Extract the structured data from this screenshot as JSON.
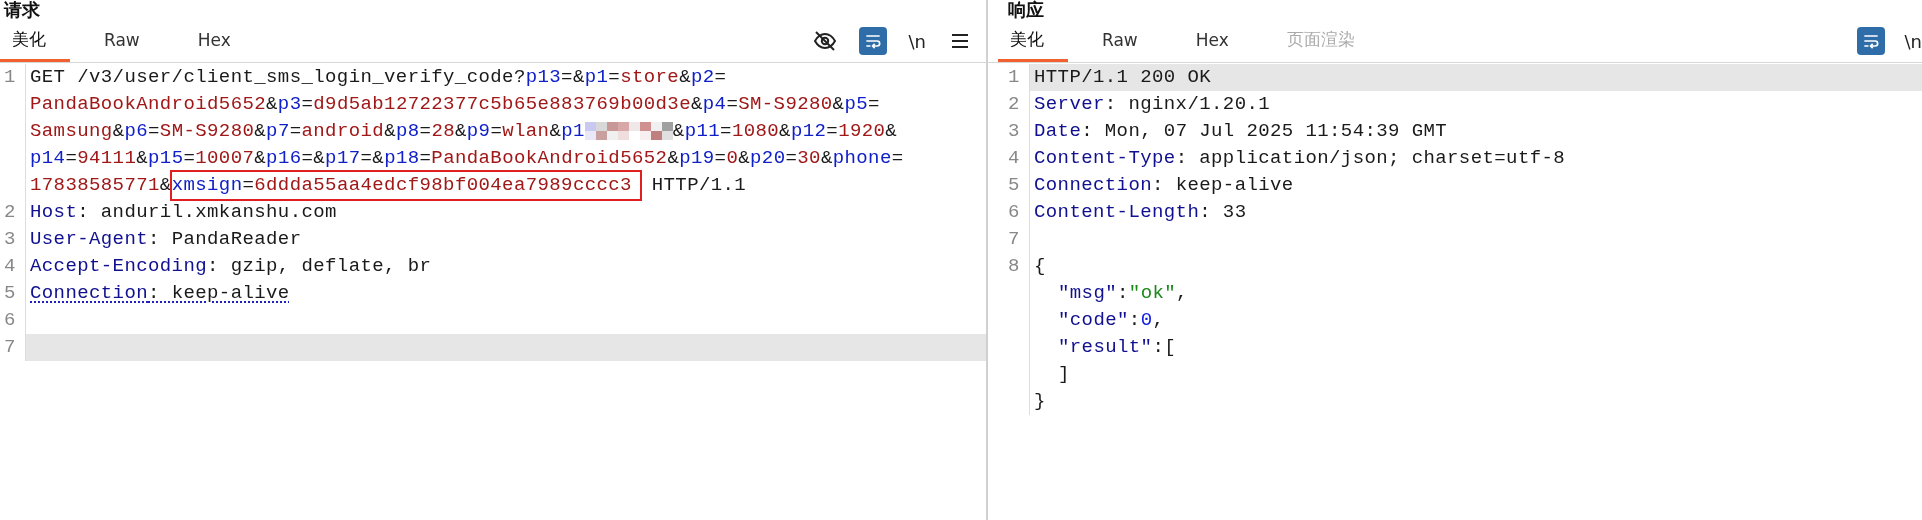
{
  "panels": [
    {
      "title": "请求",
      "tabs": [
        {
          "label": "美化",
          "selected": true,
          "disabled": false
        },
        {
          "label": "Raw",
          "selected": false,
          "disabled": false
        },
        {
          "label": "Hex",
          "selected": false,
          "disabled": false
        }
      ],
      "toolbar": [
        {
          "kind": "visibility"
        },
        {
          "kind": "wrap",
          "on": true
        },
        {
          "kind": "text",
          "text": "\\n"
        },
        {
          "kind": "menu"
        }
      ],
      "lines": [
        {
          "number": "1",
          "current": false,
          "rows": [
            {
              "segments": [
                {
                  "kind": "plain",
                  "text": "GET /v3/user/client_sms_login_verify_code?"
                },
                {
                  "kind": "param",
                  "text": "p13"
                },
                {
                  "kind": "plain",
                  "text": "=&"
                },
                {
                  "kind": "param",
                  "text": "p1"
                },
                {
                  "kind": "plain",
                  "text": "="
                },
                {
                  "kind": "value",
                  "text": "store"
                },
                {
                  "kind": "plain",
                  "text": "&"
                },
                {
                  "kind": "param",
                  "text": "p2"
                },
                {
                  "kind": "plain",
                  "text": "="
                }
              ]
            },
            {
              "segments": [
                {
                  "kind": "value",
                  "text": "PandaBookAndroid5652"
                },
                {
                  "kind": "plain",
                  "text": "&"
                },
                {
                  "kind": "param",
                  "text": "p3"
                },
                {
                  "kind": "plain",
                  "text": "="
                },
                {
                  "kind": "value",
                  "text": "d9d5ab12722377c5b65e883769b00d3e"
                },
                {
                  "kind": "plain",
                  "text": "&"
                },
                {
                  "kind": "param",
                  "text": "p4"
                },
                {
                  "kind": "plain",
                  "text": "="
                },
                {
                  "kind": "value",
                  "text": "SM-S9280"
                },
                {
                  "kind": "plain",
                  "text": "&"
                },
                {
                  "kind": "param",
                  "text": "p5"
                },
                {
                  "kind": "plain",
                  "text": "="
                }
              ]
            },
            {
              "segments": [
                {
                  "kind": "value",
                  "text": "Samsung"
                },
                {
                  "kind": "plain",
                  "text": "&"
                },
                {
                  "kind": "param",
                  "text": "p6"
                },
                {
                  "kind": "plain",
                  "text": "="
                },
                {
                  "kind": "value",
                  "text": "SM-S9280"
                },
                {
                  "kind": "plain",
                  "text": "&"
                },
                {
                  "kind": "param",
                  "text": "p7"
                },
                {
                  "kind": "plain",
                  "text": "="
                },
                {
                  "kind": "value",
                  "text": "android"
                },
                {
                  "kind": "plain",
                  "text": "&"
                },
                {
                  "kind": "param",
                  "text": "p8"
                },
                {
                  "kind": "plain",
                  "text": "="
                },
                {
                  "kind": "value",
                  "text": "28"
                },
                {
                  "kind": "plain",
                  "text": "&"
                },
                {
                  "kind": "param",
                  "text": "p9"
                },
                {
                  "kind": "plain",
                  "text": "="
                },
                {
                  "kind": "value",
                  "text": "wlan"
                },
                {
                  "kind": "plain",
                  "text": "&"
                },
                {
                  "kind": "param",
                  "text": "p1"
                },
                {
                  "kind": "redacted"
                },
                {
                  "kind": "plain",
                  "text": "&"
                },
                {
                  "kind": "param",
                  "text": "p11"
                },
                {
                  "kind": "plain",
                  "text": "="
                },
                {
                  "kind": "value",
                  "text": "1080"
                },
                {
                  "kind": "plain",
                  "text": "&"
                },
                {
                  "kind": "param",
                  "text": "p12"
                },
                {
                  "kind": "plain",
                  "text": "="
                },
                {
                  "kind": "value",
                  "text": "1920"
                },
                {
                  "kind": "plain",
                  "text": "&"
                }
              ]
            },
            {
              "segments": [
                {
                  "kind": "param",
                  "text": "p14"
                },
                {
                  "kind": "plain",
                  "text": "="
                },
                {
                  "kind": "value",
                  "text": "94111"
                },
                {
                  "kind": "plain",
                  "text": "&"
                },
                {
                  "kind": "param",
                  "text": "p15"
                },
                {
                  "kind": "plain",
                  "text": "="
                },
                {
                  "kind": "value",
                  "text": "10007"
                },
                {
                  "kind": "plain",
                  "text": "&"
                },
                {
                  "kind": "param",
                  "text": "p16"
                },
                {
                  "kind": "plain",
                  "text": "=&"
                },
                {
                  "kind": "param",
                  "text": "p17"
                },
                {
                  "kind": "plain",
                  "text": "=&"
                },
                {
                  "kind": "param",
                  "text": "p18"
                },
                {
                  "kind": "plain",
                  "text": "="
                },
                {
                  "kind": "value",
                  "text": "PandaBookAndroid5652"
                },
                {
                  "kind": "plain",
                  "text": "&"
                },
                {
                  "kind": "param",
                  "text": "p19"
                },
                {
                  "kind": "plain",
                  "text": "="
                },
                {
                  "kind": "value",
                  "text": "0"
                },
                {
                  "kind": "plain",
                  "text": "&"
                },
                {
                  "kind": "param",
                  "text": "p20"
                },
                {
                  "kind": "plain",
                  "text": "="
                },
                {
                  "kind": "value",
                  "text": "30"
                },
                {
                  "kind": "plain",
                  "text": "&"
                },
                {
                  "kind": "param",
                  "text": "phone"
                },
                {
                  "kind": "plain",
                  "text": "="
                }
              ]
            },
            {
              "segments": [
                {
                  "kind": "value",
                  "text": "17838585771"
                },
                {
                  "kind": "plain",
                  "text": "&"
                },
                {
                  "kind": "box",
                  "parts": [
                    {
                      "kind": "param",
                      "text": "xmsign"
                    },
                    {
                      "kind": "plain",
                      "text": "="
                    },
                    {
                      "kind": "value",
                      "text": "6ddda55aa4edcf98bf004ea7989cccc3"
                    }
                  ]
                },
                {
                  "kind": "plain",
                  "text": " HTTP/1.1"
                }
              ]
            }
          ]
        },
        {
          "number": "2",
          "current": false,
          "rows": [
            {
              "segments": [
                {
                  "kind": "name",
                  "text": "Host"
                },
                {
                  "kind": "plain",
                  "text": ": anduril.xmkanshu.com"
                }
              ]
            }
          ]
        },
        {
          "number": "3",
          "current": false,
          "rows": [
            {
              "segments": [
                {
                  "kind": "name",
                  "text": "User-Agent"
                },
                {
                  "kind": "plain",
                  "text": ": PandaReader"
                }
              ]
            }
          ]
        },
        {
          "number": "4",
          "current": false,
          "rows": [
            {
              "segments": [
                {
                  "kind": "name",
                  "text": "Accept-Encoding"
                },
                {
                  "kind": "plain",
                  "text": ": gzip, deflate, br"
                }
              ]
            }
          ]
        },
        {
          "number": "5",
          "current": false,
          "warning": true,
          "rows": [
            {
              "segments": [
                {
                  "kind": "name",
                  "text": "Connection"
                },
                {
                  "kind": "plain",
                  "text": ": keep-alive"
                }
              ]
            }
          ]
        },
        {
          "number": "6",
          "current": false,
          "rows": [
            {
              "segments": []
            }
          ]
        },
        {
          "number": "7",
          "current": true,
          "rows": [
            {
              "segments": []
            }
          ]
        }
      ]
    },
    {
      "title": "响应",
      "tabs": [
        {
          "label": "美化",
          "selected": true,
          "disabled": false
        },
        {
          "label": "Raw",
          "selected": false,
          "disabled": false
        },
        {
          "label": "Hex",
          "selected": false,
          "disabled": false
        },
        {
          "label": "页面渲染",
          "selected": false,
          "disabled": true
        }
      ],
      "toolbar": [
        {
          "kind": "wrap",
          "on": true
        },
        {
          "kind": "text",
          "text": "\\n"
        }
      ],
      "lines": [
        {
          "number": "1",
          "current": true,
          "rows": [
            {
              "segments": [
                {
                  "kind": "plain",
                  "text": "HTTP/1.1 200 OK"
                }
              ]
            }
          ]
        },
        {
          "number": "2",
          "current": false,
          "rows": [
            {
              "segments": [
                {
                  "kind": "name",
                  "text": "Server"
                },
                {
                  "kind": "plain",
                  "text": ": nginx/1.20.1"
                }
              ]
            }
          ]
        },
        {
          "number": "3",
          "current": false,
          "rows": [
            {
              "segments": [
                {
                  "kind": "name",
                  "text": "Date"
                },
                {
                  "kind": "plain",
                  "text": ": Mon, 07 Jul 2025 11:54:39 GMT"
                }
              ]
            }
          ]
        },
        {
          "number": "4",
          "current": false,
          "rows": [
            {
              "segments": [
                {
                  "kind": "name",
                  "text": "Content-Type"
                },
                {
                  "kind": "plain",
                  "text": ": application/json; charset=utf-8"
                }
              ]
            }
          ]
        },
        {
          "number": "5",
          "current": false,
          "rows": [
            {
              "segments": [
                {
                  "kind": "name",
                  "text": "Connection"
                },
                {
                  "kind": "plain",
                  "text": ": keep-alive"
                }
              ]
            }
          ]
        },
        {
          "number": "6",
          "current": false,
          "rows": [
            {
              "segments": [
                {
                  "kind": "name",
                  "text": "Content-Length"
                },
                {
                  "kind": "plain",
                  "text": ": 33"
                }
              ]
            }
          ]
        },
        {
          "number": "7",
          "current": false,
          "rows": [
            {
              "segments": []
            }
          ]
        },
        {
          "number": "8",
          "current": false,
          "rows": [
            {
              "segments": [
                {
                  "kind": "plain",
                  "text": "{"
                }
              ]
            },
            {
              "segments": [
                {
                  "kind": "indent"
                },
                {
                  "kind": "name",
                  "text": "\"msg\""
                },
                {
                  "kind": "plain",
                  "text": ":"
                },
                {
                  "kind": "string",
                  "text": "\"ok\""
                },
                {
                  "kind": "plain",
                  "text": ","
                }
              ]
            },
            {
              "segments": [
                {
                  "kind": "indent"
                },
                {
                  "kind": "name",
                  "text": "\"code\""
                },
                {
                  "kind": "plain",
                  "text": ":"
                },
                {
                  "kind": "number",
                  "text": "0"
                },
                {
                  "kind": "plain",
                  "text": ","
                }
              ]
            },
            {
              "segments": [
                {
                  "kind": "indent"
                },
                {
                  "kind": "name",
                  "text": "\"result\""
                },
                {
                  "kind": "plain",
                  "text": ":["
                }
              ]
            },
            {
              "segments": [
                {
                  "kind": "indent"
                },
                {
                  "kind": "plain",
                  "text": "]"
                }
              ]
            },
            {
              "segments": [
                {
                  "kind": "plain",
                  "text": "}"
                }
              ]
            }
          ]
        }
      ]
    }
  ]
}
